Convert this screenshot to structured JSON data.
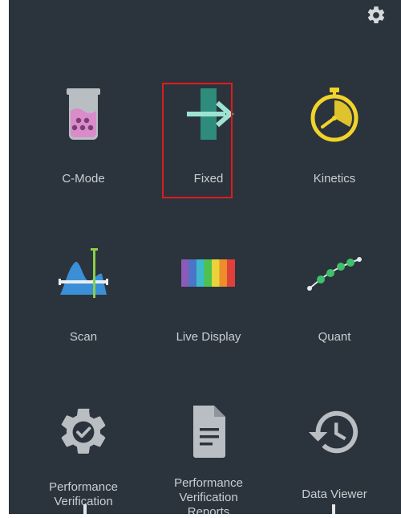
{
  "settings": {
    "icon": "gear-icon"
  },
  "modes": [
    {
      "label": "C-Mode",
      "icon": "beaker-icon"
    },
    {
      "label": "Fixed",
      "icon": "fixed-wavelength-icon",
      "selected": true
    },
    {
      "label": "Kinetics",
      "icon": "stopwatch-icon"
    },
    {
      "label": "Scan",
      "icon": "scan-spectrum-icon"
    },
    {
      "label": "Live Display",
      "icon": "spectrum-bar-icon"
    },
    {
      "label": "Quant",
      "icon": "quant-curve-icon"
    },
    {
      "label": "Performance\nVerification",
      "icon": "gear-check-icon"
    },
    {
      "label": "Performance\nVerification\nReports",
      "icon": "document-icon"
    },
    {
      "label": "Data Viewer",
      "icon": "history-clock-icon"
    }
  ],
  "colors": {
    "background": "#2b343c",
    "label": "#c9ced3",
    "highlight": "#e01b1b",
    "teal": "#2e8c7c",
    "yellow": "#f2d32a",
    "pink": "#d98cc9",
    "blue": "#3b8fd6",
    "green": "#3ec16a",
    "gray_icon": "#b9bec3"
  }
}
